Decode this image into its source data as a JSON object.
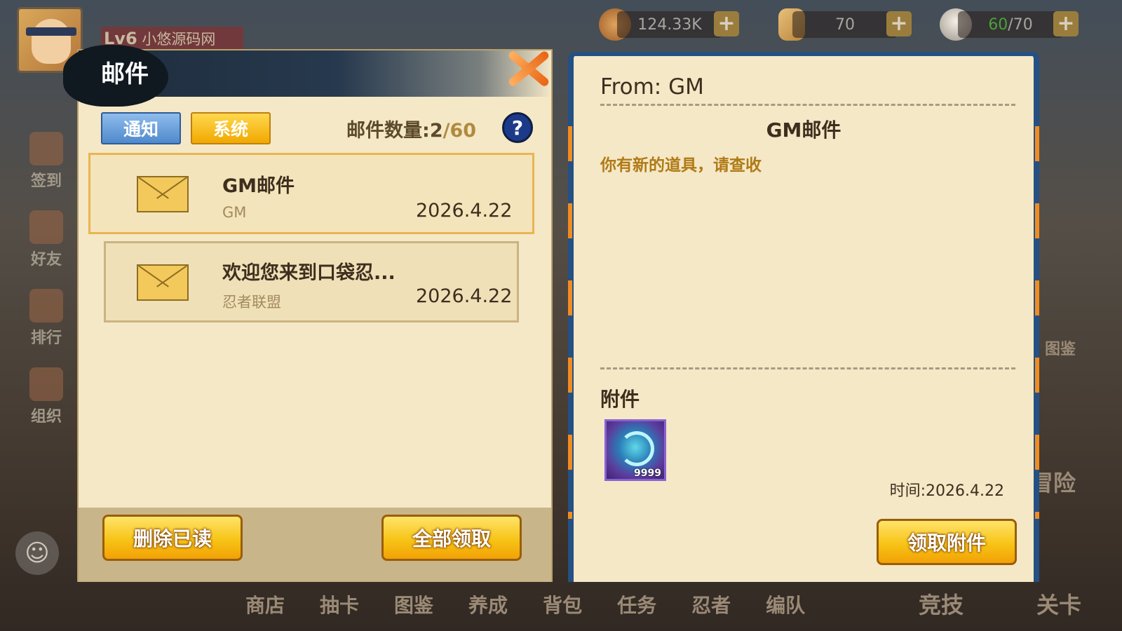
{
  "player": {
    "level": "Lv6",
    "name": "小悠源码网"
  },
  "resources": [
    {
      "icon": "coin-icon",
      "value": "124.33K"
    },
    {
      "icon": "scroll-icon",
      "value": "70"
    },
    {
      "icon": "rice-ball-icon",
      "value_current": "60",
      "value_max": "/70"
    }
  ],
  "side_menu": [
    {
      "label": "签到"
    },
    {
      "label": "好友"
    },
    {
      "label": "排行"
    },
    {
      "label": "组织"
    }
  ],
  "side_right": {
    "gallery": "图鉴",
    "adventure": "冒险"
  },
  "bottom_nav": [
    "商店",
    "抽卡",
    "图鉴",
    "养成",
    "背包",
    "任务",
    "忍者",
    "编队"
  ],
  "bottom_right": {
    "arena": "竞技",
    "stage": "关卡"
  },
  "mail": {
    "title": "邮件",
    "tabs": {
      "notice": "通知",
      "system": "系统"
    },
    "count_label": "邮件数量:",
    "count_current": "2",
    "count_max": "/60",
    "help": "?",
    "items": [
      {
        "subject": "GM邮件",
        "sender": "GM",
        "date": "2026.4.22"
      },
      {
        "subject": "欢迎您来到口袋忍...",
        "sender": "忍者联盟",
        "date": "2026.4.22"
      }
    ],
    "delete_read": "删除已读",
    "claim_all": "全部领取"
  },
  "detail": {
    "from": "From: GM",
    "title": "GM邮件",
    "body": "你有新的道具，请查收",
    "attachment_label": "附件",
    "attachment_qty": "9999",
    "time": "时间:2026.4.22",
    "claim": "领取附件"
  },
  "colors": {
    "panel_bg": "#f4e8c7",
    "header_ink": "#1e2c3c",
    "tab_blue": "#4f89cc",
    "tab_yellow": "#f1a800",
    "button_gold": "#f7c416",
    "body_text_orange": "#b07a16",
    "detail_frame_blue": "#245083"
  }
}
